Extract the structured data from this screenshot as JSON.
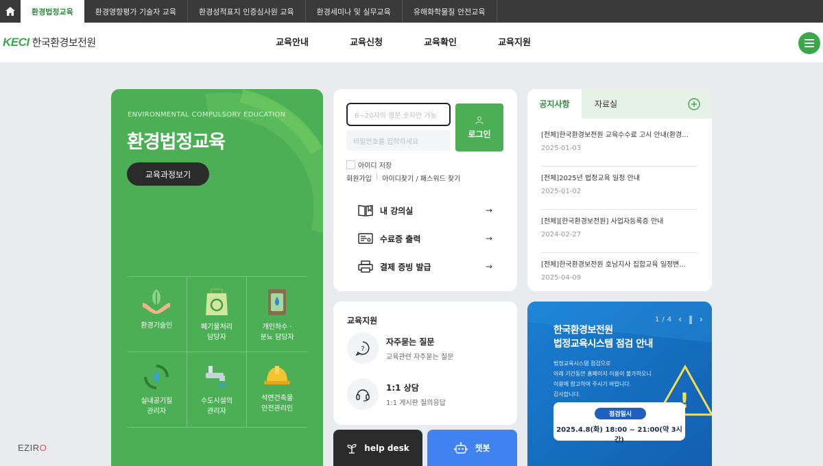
{
  "topbar": {
    "tabs": [
      "환경법정교육",
      "환경영향평가 기술자 교육",
      "환경성적표지 인증심사원 교육",
      "환경세미나 및 실무교육",
      "유해화학물질 안전교육"
    ]
  },
  "header": {
    "logo_mark": "KECI",
    "logo_text": "한국환경보전원",
    "nav": [
      "교육안내",
      "교육신청",
      "교육확인",
      "교육지원"
    ]
  },
  "hero": {
    "subtitle": "ENVIRONMENTAL COMPULSORY EDUCATION",
    "title": "환경법정교육",
    "button": "교육과정보기",
    "categories": [
      {
        "label": "환경기술인",
        "icon": "hands-leaf-icon"
      },
      {
        "label": "폐기물처리\n담당자",
        "icon": "recycle-bag-icon"
      },
      {
        "label": "개인하수 ·\n분뇨 담당자",
        "icon": "water-tank-icon"
      },
      {
        "label": "실내공기질\n관리자",
        "icon": "air-recycle-icon"
      },
      {
        "label": "수도시설의\n관리자",
        "icon": "faucet-icon"
      },
      {
        "label": "석면건축물\n안전관리인",
        "icon": "hard-hat-icon"
      }
    ]
  },
  "login": {
    "id_placeholder": "6~20자의 영문,숫자만 가능",
    "pw_placeholder": "비밀번호를 입력하세요",
    "button": "로그인",
    "remember": "아이디 저장",
    "links": [
      "회원가입",
      "아이디찾기 / 패스워드 찾기"
    ],
    "quick": [
      {
        "label": "내 강의실",
        "icon": "book-icon"
      },
      {
        "label": "수료증 출력",
        "icon": "certificate-icon"
      },
      {
        "label": "결제 증빙 발급",
        "icon": "printer-icon"
      }
    ],
    "arrow": "→"
  },
  "notice": {
    "tabs": [
      "공지사항",
      "자료실"
    ],
    "items": [
      {
        "title": "[전체]한국환경보전원 교육수수료 고시 안내(환경...",
        "date": "2025-01-03"
      },
      {
        "title": "[전체]2025년 법정교육 일정 안내",
        "date": "2025-01-02"
      },
      {
        "title": "[전체][한국환경보전원] 사업자등록증 안내",
        "date": "2024-02-27"
      },
      {
        "title": "[전체]한국환경보전원 호남지사 집합교육 일정변...",
        "date": "2025-04-09"
      }
    ]
  },
  "support": {
    "title": "교육지원",
    "items": [
      {
        "name": "자주묻는 질문",
        "desc": "교육관련 자주묻는 질문",
        "icon": "question-bubble-icon"
      },
      {
        "name": "1:1 상담",
        "desc": "1:1 게시판 질의응답",
        "icon": "headset-icon"
      }
    ]
  },
  "bottom": {
    "helpdesk": "help desk",
    "chatbot": "챗봇"
  },
  "banner": {
    "current": "1",
    "sep": "/",
    "total": "4",
    "title": "한국환경보전원\n법정교육시스템 점검 안내",
    "desc": "법정교육시스템 점검으로\n아래 기간동안 홈페이지 이용이 불가하오니\n이용에 참고하여 주시기 바랍니다.\n감사합니다.",
    "badge": "점검일시",
    "time": "2025.4.8(화) 18:00 ~ 21:00(약 3시간)"
  },
  "brand": {
    "prefix": "EZIR",
    "suffix": "O"
  },
  "colors": {
    "green": "#4caf55",
    "dark": "#2b2b2b",
    "blue": "#3f82f0",
    "banner_blue": "#1777c9"
  }
}
